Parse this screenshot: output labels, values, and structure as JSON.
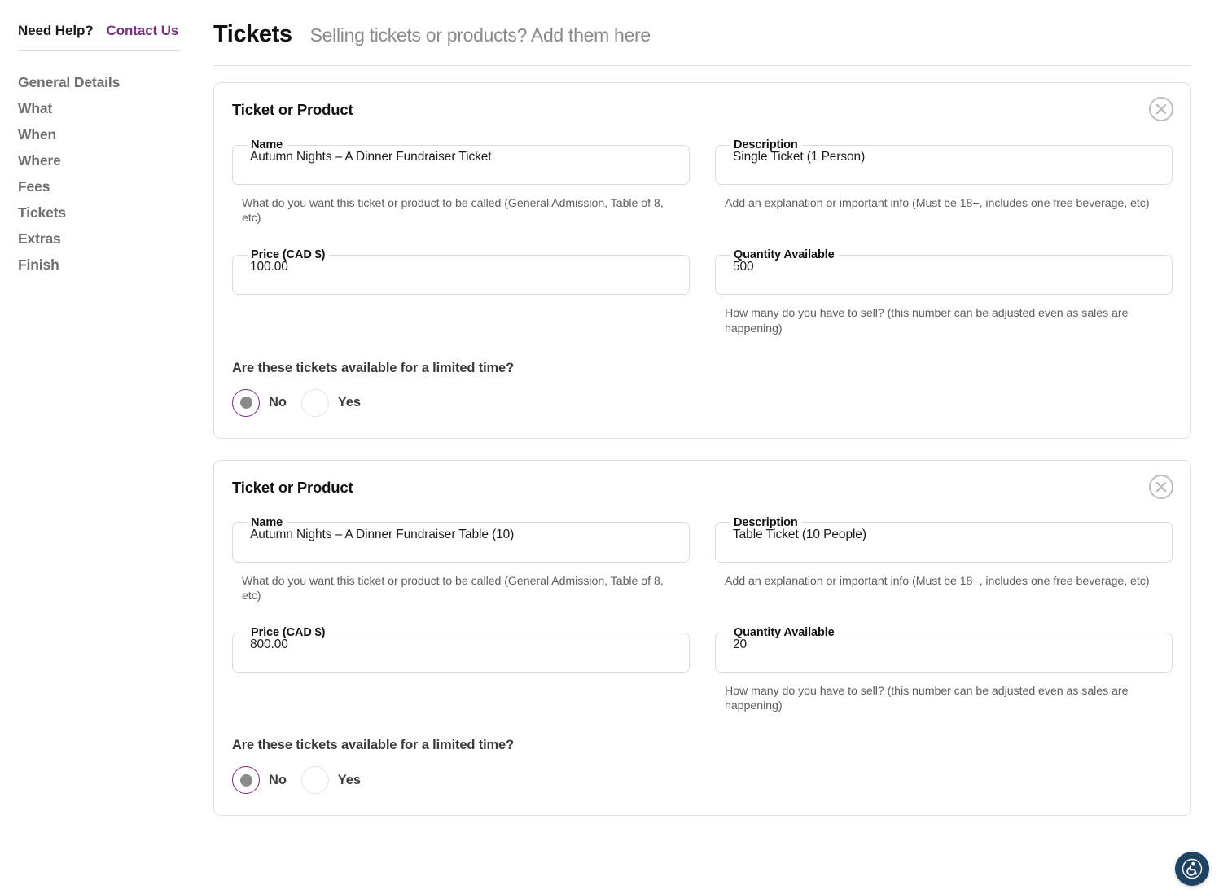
{
  "sidebar": {
    "help_label": "Need Help?",
    "help_link": "Contact Us",
    "items": [
      {
        "label": "General Details"
      },
      {
        "label": "What"
      },
      {
        "label": "When"
      },
      {
        "label": "Where"
      },
      {
        "label": "Fees"
      },
      {
        "label": "Tickets"
      },
      {
        "label": "Extras"
      },
      {
        "label": "Finish"
      }
    ]
  },
  "header": {
    "title": "Tickets",
    "subtitle": "Selling tickets or products? Add them here"
  },
  "labels": {
    "card_title": "Ticket or Product",
    "name": "Name",
    "description": "Description",
    "price": "Price (CAD $)",
    "quantity": "Quantity Available",
    "name_helper": "What do you want this ticket or product to be called (General Admission, Table of 8, etc)",
    "description_helper": "Add an explanation or important info (Must be 18+, includes one free beverage, etc)",
    "quantity_helper": "How many do you have to sell? (this number can be adjusted even as sales are happening)",
    "limited_time_question": "Are these tickets available for a limited time?",
    "radio_no": "No",
    "radio_yes": "Yes",
    "close_icon": "close-circle-icon",
    "accessibility_icon": "accessibility-wheelchair-icon"
  },
  "colors": {
    "accent_purple": "#7a2b82",
    "radio_dot_gray": "#8a8a8a",
    "card_border": "#e0e0e0",
    "a11y_navy": "#1f4263"
  },
  "tickets": [
    {
      "name": "Autumn Nights – A Dinner Fundraiser Ticket",
      "description": "Single Ticket (1 Person)",
      "price": "100.00",
      "quantity": "500",
      "limited_time_selected": "No"
    },
    {
      "name": "Autumn Nights – A Dinner Fundraiser Table (10)",
      "description": "Table Ticket (10 People)",
      "price": "800.00",
      "quantity": "20",
      "limited_time_selected": "No"
    }
  ]
}
